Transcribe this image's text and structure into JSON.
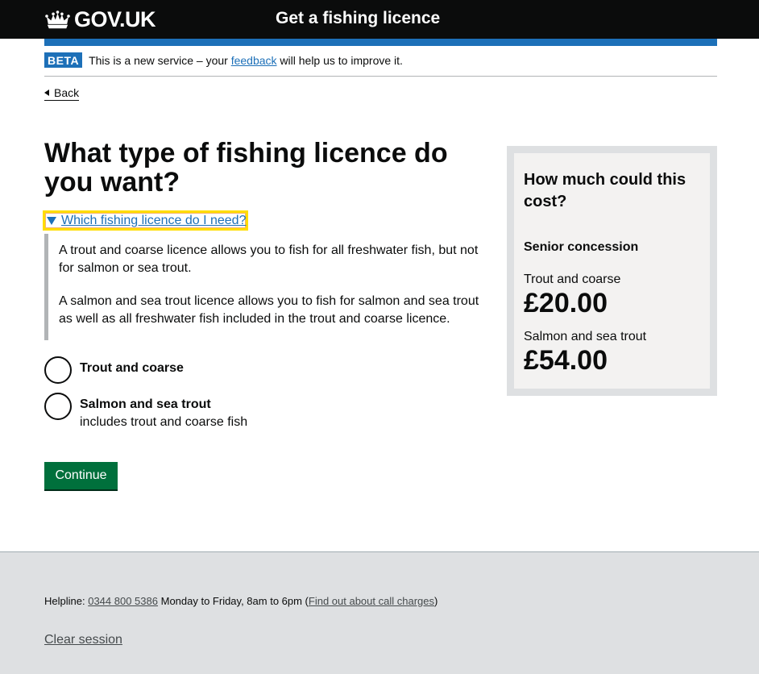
{
  "header": {
    "logo_text": "GOV.UK",
    "service_name": "Get a fishing licence"
  },
  "phase_banner": {
    "tag": "BETA",
    "text_before": "This is a new service – your",
    "link": "feedback",
    "text_after": "will help us to improve it."
  },
  "back_link": "Back",
  "main": {
    "heading": "What type of fishing licence do you want?",
    "details": {
      "summary": "Which fishing licence do I need?",
      "paragraphs": [
        "A trout and coarse licence allows you to fish for all freshwater fish, but not for salmon or sea trout.",
        "A salmon and sea trout licence allows you to fish for salmon and sea trout as well as all freshwater fish included in the trout and coarse licence."
      ]
    },
    "options": [
      {
        "label": "Trout and coarse",
        "hint": ""
      },
      {
        "label": "Salmon and sea trout",
        "hint": "includes trout and coarse fish"
      }
    ],
    "continue_label": "Continue"
  },
  "aside": {
    "title": "How much could this cost?",
    "subtitle": "Senior concession",
    "prices": [
      {
        "label": "Trout and coarse",
        "price": "£20.00"
      },
      {
        "label": "Salmon and sea trout",
        "price": "£54.00"
      }
    ]
  },
  "footer": {
    "helpline_label": "Helpline:",
    "helpline_number": "0344 800 5386",
    "helpline_hours": "Monday to Friday, 8am to 6pm (",
    "call_charges_link": "Find out about call charges",
    "helpline_close": ")",
    "clear_session": "Clear session"
  },
  "colors": {
    "header_bg": "#0b0c0c",
    "brand_blue": "#1d70b8",
    "button_green": "#00703c",
    "focus_yellow": "#ffdd00",
    "footer_bg": "#dee0e2"
  },
  "icons": {
    "logo": "crown-icon",
    "details_toggle": "triangle-down-icon",
    "back": "triangle-left-icon"
  }
}
